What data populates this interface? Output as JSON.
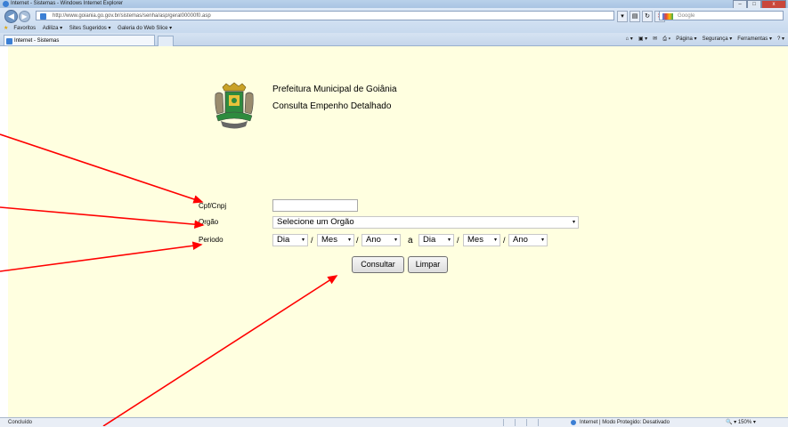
{
  "browser": {
    "title": "Internet - Sistemas - Windows Internet Explorer",
    "url": "http://www.goiania.go.gov.br/sistemas/senha/asp/geral00000f0.asp",
    "search_placeholder": "Google",
    "favorites": [
      "Favoritos",
      "Adiliza ▾",
      "Sites Sugeridos ▾",
      "Galeria do Web Slice ▾"
    ],
    "tab_label": "Internet - Sistemas",
    "commands": [
      "Página ▾",
      "Segurança ▾",
      "Ferramentas ▾"
    ],
    "status_left": "Concluído",
    "status_zone": "Internet | Modo Protegido: Desativado",
    "zoom": "150%"
  },
  "header": {
    "line1": "Prefeitura Municipal de Goiânia",
    "line2": "Consulta Empenho Detalhado"
  },
  "form": {
    "cpf_label": "Cpf/Cnpj",
    "orgao_label": "Orgão",
    "periodo_label": "Periodo",
    "orgao_select": "Selecione um Orgão",
    "dia1": "Dia",
    "mes1": "Mes",
    "ano1": "Ano",
    "separator_a": "a",
    "dia2": "Dia",
    "mes2": "Mes",
    "ano2": "Ano",
    "slash": "/",
    "consultar": "Consultar",
    "limpar": "Limpar"
  },
  "colors": {
    "page_bg": "#ffffe0",
    "annotation": "#ff0000"
  }
}
